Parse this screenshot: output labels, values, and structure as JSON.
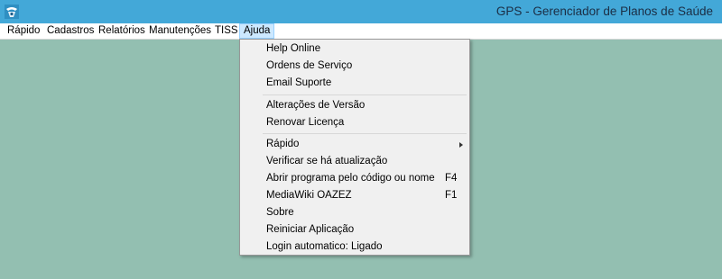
{
  "window": {
    "title": "GPS - Gerenciador de Planos de Saúde",
    "icon": "app-logo-icon"
  },
  "menubar": {
    "items": [
      {
        "label": "Rápido"
      },
      {
        "label": "Cadastros"
      },
      {
        "label": "Relatórios"
      },
      {
        "label": "Manutenções"
      },
      {
        "label": "TISS"
      },
      {
        "label": "Ajuda",
        "active": true
      }
    ]
  },
  "ajuda_menu": {
    "items": [
      {
        "label": "Help Online"
      },
      {
        "label": "Ordens de Serviço"
      },
      {
        "label": "Email Suporte"
      },
      {
        "label": "Alterações de Versão"
      },
      {
        "label": "Renovar Licença"
      },
      {
        "label": "Rápido",
        "submenu": true
      },
      {
        "label": "Verificar se há atualização"
      },
      {
        "label": "Abrir programa pelo código ou nome",
        "shortcut": "F4"
      },
      {
        "label": "MediaWiki OAZEZ",
        "shortcut": "F1"
      },
      {
        "label": "Sobre"
      },
      {
        "label": "Reiniciar Aplicação"
      },
      {
        "label": "Login automatico: Ligado"
      }
    ]
  },
  "colors": {
    "titlebar": "#43a8d8",
    "client_background": "#93bfb1",
    "menu_background": "#f0f0f0",
    "active_menu_highlight": "#cce8ff"
  }
}
